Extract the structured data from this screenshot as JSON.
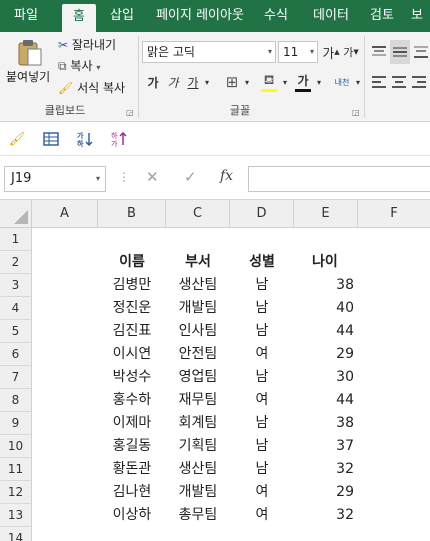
{
  "ribbon_tabs": [
    "파일",
    "홈",
    "삽입",
    "페이지 레이아웃",
    "수식",
    "데이터",
    "검토",
    "보"
  ],
  "active_tab": "홈",
  "clipboard": {
    "paste_label": "붙여넣기",
    "cut_label": "잘라내기",
    "copy_label": "복사",
    "format_painter_label": "서식 복사",
    "group_label": "클립보드"
  },
  "font": {
    "name": "맑은 고딕",
    "size": "11",
    "grow_label": "가",
    "shrink_label": "가",
    "bold_label": "가",
    "italic_label": "가",
    "underline_label": "가",
    "phonetic_label": "내천",
    "group_label": "글꼴"
  },
  "formula_bar": {
    "name_box": "J19",
    "fx_label": "fx",
    "formula": ""
  },
  "columns": [
    "A",
    "B",
    "C",
    "D",
    "E",
    "F"
  ],
  "rows": [
    "1",
    "2",
    "3",
    "4",
    "5",
    "6",
    "7",
    "8",
    "9",
    "10",
    "11",
    "12",
    "13",
    "14"
  ],
  "table": {
    "headers": [
      "이름",
      "부서",
      "성별",
      "나이"
    ],
    "records": [
      [
        "김병만",
        "생산팀",
        "남",
        "38"
      ],
      [
        "정진운",
        "개발팀",
        "남",
        "40"
      ],
      [
        "김진표",
        "인사팀",
        "남",
        "44"
      ],
      [
        "이시연",
        "안전팀",
        "여",
        "29"
      ],
      [
        "박성수",
        "영업팀",
        "남",
        "30"
      ],
      [
        "홍수하",
        "재무팀",
        "여",
        "44"
      ],
      [
        "이제마",
        "회계팀",
        "남",
        "38"
      ],
      [
        "홍길동",
        "기획팀",
        "남",
        "37"
      ],
      [
        "황돈관",
        "생산팀",
        "남",
        "32"
      ],
      [
        "김나현",
        "개발팀",
        "여",
        "29"
      ],
      [
        "이상하",
        "총무팀",
        "여",
        "32"
      ]
    ]
  },
  "colors": {
    "ribbon_green": "#217346",
    "ribbon_bg": "#f3f3f3",
    "header_bg": "#efefef"
  }
}
